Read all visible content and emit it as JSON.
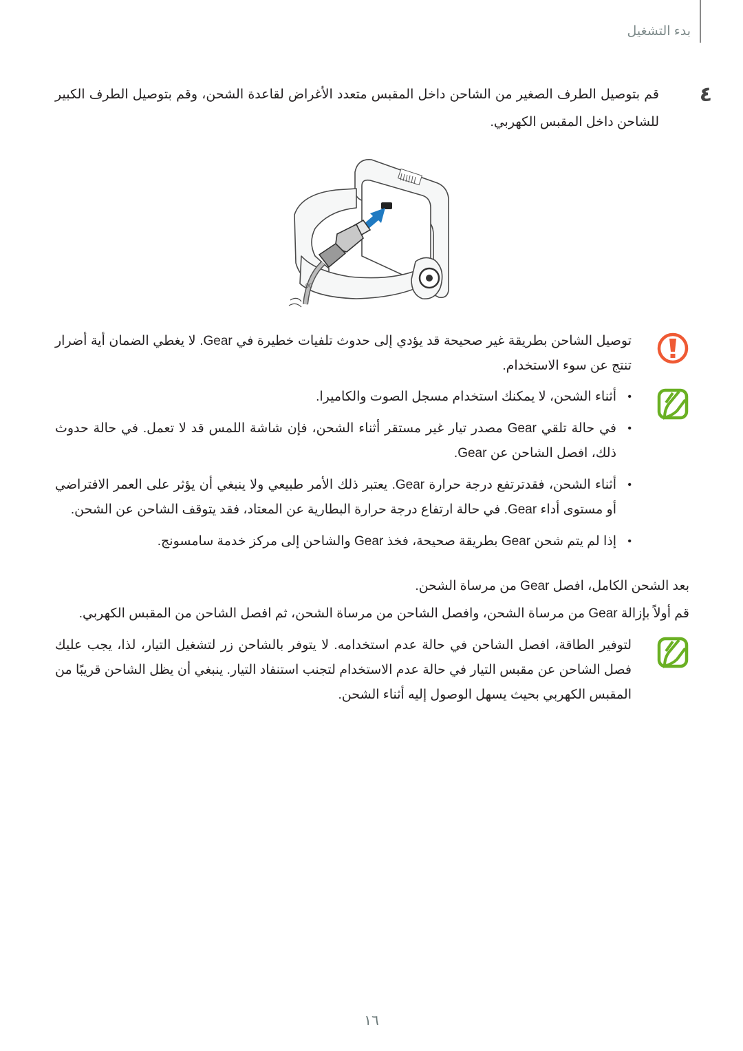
{
  "header": {
    "section_title": "بدء التشغيل"
  },
  "step": {
    "number": "٤",
    "text": "قم بتوصيل الطرف الصغير من الشاحن داخل المقبس متعدد الأغراض لقاعدة الشحن، وقم بتوصيل الطرف الكبير للشاحن داخل المقبس الكهربي."
  },
  "illustration": {
    "description": "Charger cable connected to charging dock of Gear",
    "arrow_color": "#1f7ac2"
  },
  "caution": {
    "icon": "caution-icon",
    "icon_color": "#ef5a34",
    "text": "توصيل الشاحن بطريقة غير صحيحة قد يؤدي إلى حدوث تلفيات خطيرة في Gear. لا يغطي الضمان أية أضرار تنتج عن سوء الاستخدام."
  },
  "note1": {
    "icon": "note-icon",
    "icon_color": "#6ab023",
    "bullets": [
      "أثناء الشحن، لا يمكنك استخدام مسجل الصوت والكاميرا.",
      "في حالة تلقي Gear مصدر تيار غير مستقر أثناء الشحن، فإن شاشة اللمس قد لا تعمل. في حالة حدوث ذلك، افصل الشاحن عن Gear.",
      "أثناء الشحن، فقدترتفع درجة حرارة Gear. يعتبر ذلك الأمر طبيعي ولا ينبغي أن يؤثر على العمر الافتراضي أو مستوى أداء Gear. في حالة ارتفاع درجة حرارة البطارية عن المعتاد، فقد يتوقف الشاحن عن الشحن.",
      "إذا لم يتم شحن Gear بطريقة صحيحة، فخذ Gear والشاحن إلى مركز خدمة سامسونج."
    ]
  },
  "after_charge": {
    "line1": "بعد الشحن الكامل، افصل Gear من مرساة الشحن.",
    "line2": "قم أولاً بإزالة Gear من مرساة الشحن، وافصل الشاحن من مرساة الشحن، ثم افصل الشاحن من المقبس الكهربي."
  },
  "note2": {
    "icon": "note-icon",
    "icon_color": "#6ab023",
    "text": "لتوفير الطاقة، افصل الشاحن في حالة عدم استخدامه. لا يتوفر بالشاحن زر لتشغيل التيار، لذا، يجب عليك فصل الشاحن عن مقبس التيار في حالة عدم الاستخدام لتجنب استنفاد التيار. ينبغي أن يظل الشاحن قريبًا من المقبس الكهربي بحيث يسهل الوصول إليه أثناء الشحن."
  },
  "footer": {
    "page_number": "١٦"
  }
}
